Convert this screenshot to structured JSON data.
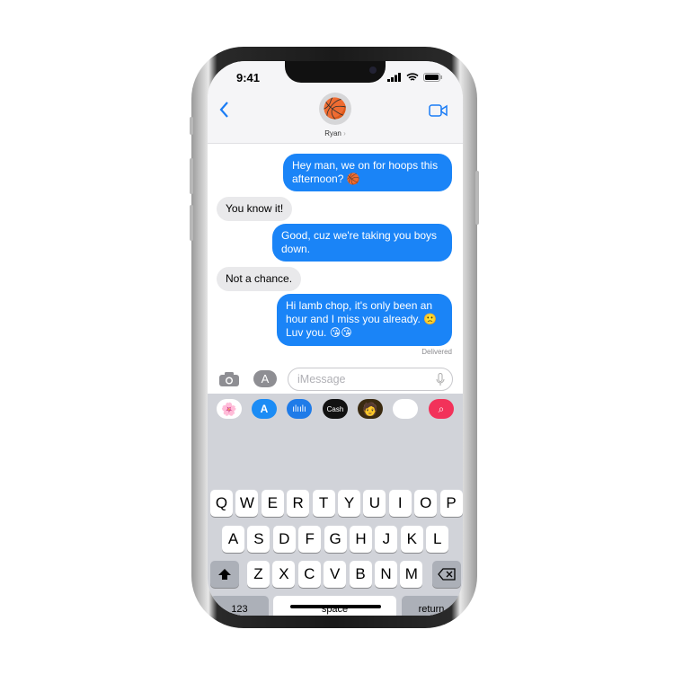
{
  "status": {
    "time": "9:41"
  },
  "header": {
    "contact_name": "Ryan",
    "avatar_emoji": "🏀",
    "back_icon": "chevron-left-icon",
    "video_icon": "video-camera-icon"
  },
  "messages": [
    {
      "direction": "outgoing",
      "text": "Hey man, we on for hoops this afternoon? 🏀"
    },
    {
      "direction": "incoming",
      "text": "You know it!"
    },
    {
      "direction": "outgoing",
      "text": "Good, cuz we're taking you boys down."
    },
    {
      "direction": "incoming",
      "text": "Not a chance."
    },
    {
      "direction": "outgoing",
      "text": "Hi lamb chop, it's only been an hour and I miss you already. 🙁 Luv you. 😘😘"
    }
  ],
  "delivered": "Delivered",
  "input": {
    "placeholder": "iMessage"
  },
  "apps": [
    "photos",
    "app-store",
    "audio",
    "Cash",
    "memoji",
    "animoji",
    "search-images"
  ],
  "keyboard": {
    "row1": [
      "Q",
      "W",
      "E",
      "R",
      "T",
      "Y",
      "U",
      "I",
      "O",
      "P"
    ],
    "row2": [
      "A",
      "S",
      "D",
      "F",
      "G",
      "H",
      "J",
      "K",
      "L"
    ],
    "row3": [
      "Z",
      "X",
      "C",
      "V",
      "B",
      "N",
      "M"
    ],
    "numbers": "123",
    "space": "space",
    "return": "return"
  },
  "colors": {
    "outgoing": "#1a84f7",
    "incoming": "#e9e9eb",
    "accent": "#1a7cf5"
  }
}
